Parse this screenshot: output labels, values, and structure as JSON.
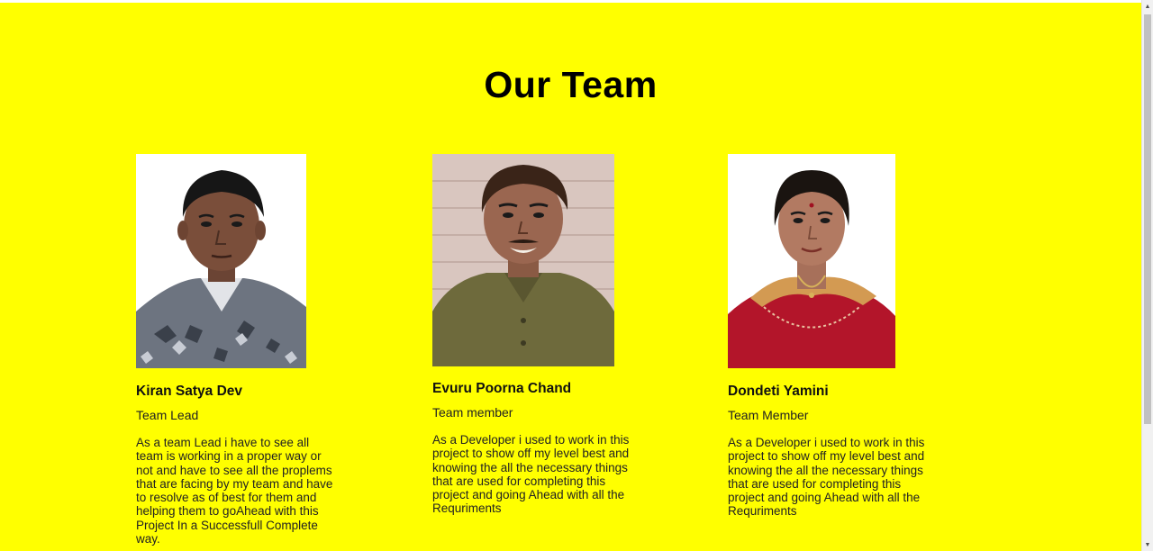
{
  "page": {
    "title": "Our Team",
    "background_color": "#ffff00"
  },
  "members": [
    {
      "name": "Kiran Satya Dev",
      "role": "Team Lead",
      "bio": "As a team Lead i have to see all team is working in a proper way or not and have to see all the proplems that are facing by my team and have to resolve as of best for them and helping them to goAhead with this Project In a Successfull Complete way.",
      "photo_icon": "portrait-photo"
    },
    {
      "name": "Evuru Poorna Chand",
      "role": "Team member",
      "bio": "As a Developer i used to work in this project to show off my level best and knowing the all the necessary things that are used for completing this project and going Ahead with all the Requriments",
      "photo_icon": "portrait-photo"
    },
    {
      "name": "Dondeti Yamini",
      "role": "Team Member",
      "bio": "As a Developer i used to work in this project to show off my level best and knowing the all the necessary things that are used for completing this project and going Ahead with all the Requriments",
      "photo_icon": "portrait-photo"
    }
  ],
  "scrollbar": {
    "up_icon": "scroll-up-arrow-icon",
    "down_icon": "scroll-down-arrow-icon"
  }
}
